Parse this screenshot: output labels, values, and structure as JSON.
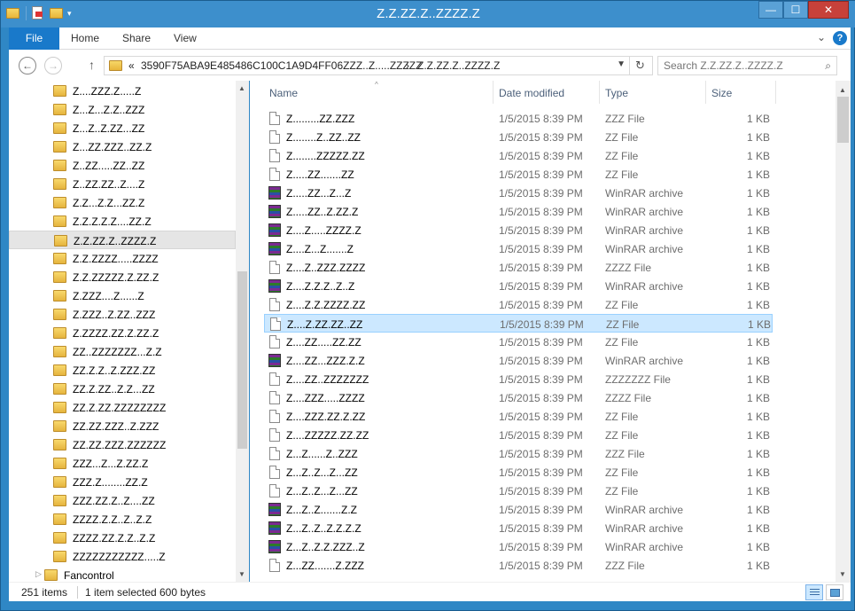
{
  "window": {
    "title": "Z.Z.ZZ.Z..ZZZZ.Z",
    "controls": {
      "minimize": "—",
      "maximize": "☐",
      "close": "✕"
    }
  },
  "ribbon": {
    "file_tab": "File",
    "tabs": [
      "Home",
      "Share",
      "View"
    ],
    "help": "?"
  },
  "address": {
    "overflow": "«",
    "crumb_parent": "3590F75ABA9E485486C100C1A9D4FF06ZZZ..Z.....ZZZZZ",
    "crumb_sep": "›",
    "crumb_current": "Z.Z.ZZ.Z..ZZZZ.Z"
  },
  "search": {
    "placeholder": "Search Z.Z.ZZ.Z..ZZZZ.Z"
  },
  "nav_pane": {
    "selected_index": 8,
    "items": [
      "Z....ZZZ.Z.....Z",
      "Z...Z...Z.Z..ZZZ",
      "Z...Z..Z.ZZ...ZZ",
      "Z...ZZ.ZZZ..ZZ.Z",
      "Z..ZZ.....ZZ..ZZ",
      "Z..ZZ.ZZ..Z....Z",
      "Z.Z...Z.Z...ZZ.Z",
      "Z.Z.Z.Z.Z....ZZ.Z",
      "Z.Z.ZZ.Z..ZZZZ.Z",
      "Z.Z.ZZZZ.....ZZZZ",
      "Z.Z.ZZZZZ.Z.ZZ.Z",
      "Z.ZZZ....Z......Z",
      "Z.ZZZ..Z.ZZ..ZZZ",
      "Z.ZZZZ.ZZ.Z.ZZ.Z",
      "ZZ..ZZZZZZZ...Z.Z",
      "ZZ.Z.Z..Z.ZZZ.ZZ",
      "ZZ.Z.ZZ..Z.Z...ZZ",
      "ZZ.Z.ZZ.ZZZZZZZZ",
      "ZZ.ZZ.ZZZ..Z.ZZZ",
      "ZZ.ZZ.ZZZ.ZZZZZZ",
      "ZZZ...Z...Z.ZZ.Z",
      "ZZZ.Z........ZZ.Z",
      "ZZZ.ZZ.Z..Z....ZZ",
      "ZZZZ.Z.Z..Z..Z.Z",
      "ZZZZ.ZZ.Z.Z..Z.Z",
      "ZZZZZZZZZZZ.....Z"
    ],
    "root_item": "Fancontrol"
  },
  "columns": {
    "name": "Name",
    "date": "Date modified",
    "type": "Type",
    "size": "Size"
  },
  "files": [
    {
      "name": "Z.........ZZ.ZZZ",
      "date": "1/5/2015 8:39 PM",
      "type": "ZZZ File",
      "size": "1 KB",
      "icon": "doc"
    },
    {
      "name": "Z........Z..ZZ..ZZ",
      "date": "1/5/2015 8:39 PM",
      "type": "ZZ File",
      "size": "1 KB",
      "icon": "doc"
    },
    {
      "name": "Z........ZZZZZ.ZZ",
      "date": "1/5/2015 8:39 PM",
      "type": "ZZ File",
      "size": "1 KB",
      "icon": "doc"
    },
    {
      "name": "Z.....ZZ.......ZZ",
      "date": "1/5/2015 8:39 PM",
      "type": "ZZ File",
      "size": "1 KB",
      "icon": "doc"
    },
    {
      "name": "Z.....ZZ...Z...Z",
      "date": "1/5/2015 8:39 PM",
      "type": "WinRAR archive",
      "size": "1 KB",
      "icon": "rar"
    },
    {
      "name": "Z.....ZZ..Z.ZZ.Z",
      "date": "1/5/2015 8:39 PM",
      "type": "WinRAR archive",
      "size": "1 KB",
      "icon": "rar"
    },
    {
      "name": "Z....Z.....ZZZZ.Z",
      "date": "1/5/2015 8:39 PM",
      "type": "WinRAR archive",
      "size": "1 KB",
      "icon": "rar"
    },
    {
      "name": "Z....Z...Z.......Z",
      "date": "1/5/2015 8:39 PM",
      "type": "WinRAR archive",
      "size": "1 KB",
      "icon": "rar"
    },
    {
      "name": "Z....Z..ZZZ.ZZZZ",
      "date": "1/5/2015 8:39 PM",
      "type": "ZZZZ File",
      "size": "1 KB",
      "icon": "doc"
    },
    {
      "name": "Z....Z.Z.Z..Z..Z",
      "date": "1/5/2015 8:39 PM",
      "type": "WinRAR archive",
      "size": "1 KB",
      "icon": "rar"
    },
    {
      "name": "Z....Z.Z.ZZZZ.ZZ",
      "date": "1/5/2015 8:39 PM",
      "type": "ZZ File",
      "size": "1 KB",
      "icon": "doc"
    },
    {
      "name": "Z....Z.ZZ.ZZ..ZZ",
      "date": "1/5/2015 8:39 PM",
      "type": "ZZ File",
      "size": "1 KB",
      "icon": "doc",
      "selected": true
    },
    {
      "name": "Z....ZZ.....ZZ.ZZ",
      "date": "1/5/2015 8:39 PM",
      "type": "ZZ File",
      "size": "1 KB",
      "icon": "doc"
    },
    {
      "name": "Z....ZZ...ZZZ.Z.Z",
      "date": "1/5/2015 8:39 PM",
      "type": "WinRAR archive",
      "size": "1 KB",
      "icon": "rar"
    },
    {
      "name": "Z....ZZ..ZZZZZZZ",
      "date": "1/5/2015 8:39 PM",
      "type": "ZZZZZZZ File",
      "size": "1 KB",
      "icon": "doc"
    },
    {
      "name": "Z....ZZZ.....ZZZZ",
      "date": "1/5/2015 8:39 PM",
      "type": "ZZZZ File",
      "size": "1 KB",
      "icon": "doc"
    },
    {
      "name": "Z....ZZZ.ZZ.Z.ZZ",
      "date": "1/5/2015 8:39 PM",
      "type": "ZZ File",
      "size": "1 KB",
      "icon": "doc"
    },
    {
      "name": "Z....ZZZZZ.ZZ.ZZ",
      "date": "1/5/2015 8:39 PM",
      "type": "ZZ File",
      "size": "1 KB",
      "icon": "doc"
    },
    {
      "name": "Z...Z......Z..ZZZ",
      "date": "1/5/2015 8:39 PM",
      "type": "ZZZ File",
      "size": "1 KB",
      "icon": "doc"
    },
    {
      "name": "Z...Z..Z...Z...ZZ",
      "date": "1/5/2015 8:39 PM",
      "type": "ZZ File",
      "size": "1 KB",
      "icon": "doc"
    },
    {
      "name": "Z...Z..Z...Z...ZZ",
      "date": "1/5/2015 8:39 PM",
      "type": "ZZ File",
      "size": "1 KB",
      "icon": "doc"
    },
    {
      "name": "Z...Z..Z.......Z.Z",
      "date": "1/5/2015 8:39 PM",
      "type": "WinRAR archive",
      "size": "1 KB",
      "icon": "rar"
    },
    {
      "name": "Z...Z..Z..Z.Z.Z.Z",
      "date": "1/5/2015 8:39 PM",
      "type": "WinRAR archive",
      "size": "1 KB",
      "icon": "rar"
    },
    {
      "name": "Z...Z..Z.Z.ZZZ..Z",
      "date": "1/5/2015 8:39 PM",
      "type": "WinRAR archive",
      "size": "1 KB",
      "icon": "rar"
    },
    {
      "name": "Z...ZZ.......Z.ZZZ",
      "date": "1/5/2015 8:39 PM",
      "type": "ZZZ File",
      "size": "1 KB",
      "icon": "doc"
    }
  ],
  "status": {
    "count": "251 items",
    "selection": "1 item selected",
    "selection_size": "600 bytes"
  }
}
